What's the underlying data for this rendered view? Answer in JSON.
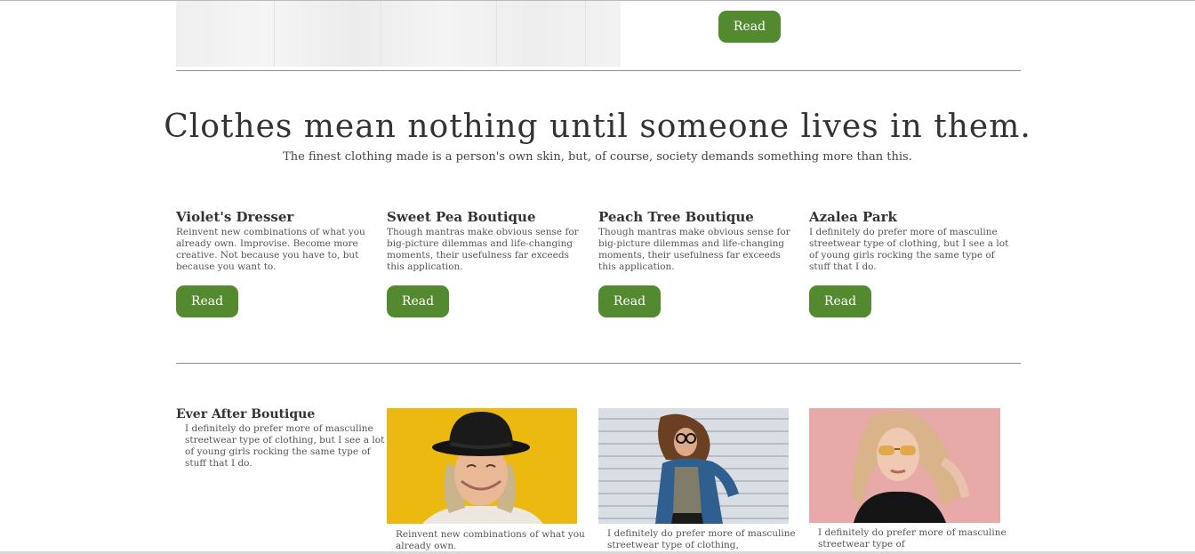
{
  "top": {
    "read_label": "Read"
  },
  "quote": {
    "headline": "Clothes mean nothing until someone lives in them.",
    "subline": "The finest clothing made is a person's own skin, but, of course, society demands something more than this."
  },
  "cards": [
    {
      "title": "Violet's Dresser",
      "text": "Reinvent new combinations of what you already own. Improvise. Become more creative. Not because you have to, but because you want to.",
      "button": "Read"
    },
    {
      "title": "Sweet Pea Boutique",
      "text": "Though mantras make obvious sense for big-picture dilemmas and life-changing moments, their usefulness far exceeds this application.",
      "button": "Read"
    },
    {
      "title": "Peach Tree Boutique",
      "text": "Though mantras make obvious sense for big-picture dilemmas and life-changing moments, their usefulness far exceeds this application.",
      "button": "Read"
    },
    {
      "title": "Azalea Park",
      "text": "I definitely do prefer more of masculine streetwear type of clothing, but I see a lot of young girls rocking the same type of stuff that I do.",
      "button": "Read"
    }
  ],
  "feature": {
    "title": "Ever After Boutique",
    "text": "I definitely do prefer more of masculine streetwear type of clothing, but I see a lot of young girls rocking the same type of stuff that I do."
  },
  "photos": [
    {
      "caption": "Reinvent new combinations of what you already own."
    },
    {
      "caption": "I definitely do prefer more of masculine streetwear type of clothing,"
    },
    {
      "caption": "I definitely do prefer more of masculine streetwear type of"
    }
  ],
  "colors": {
    "accent": "#548a2f",
    "rule": "#8c8c8c"
  }
}
